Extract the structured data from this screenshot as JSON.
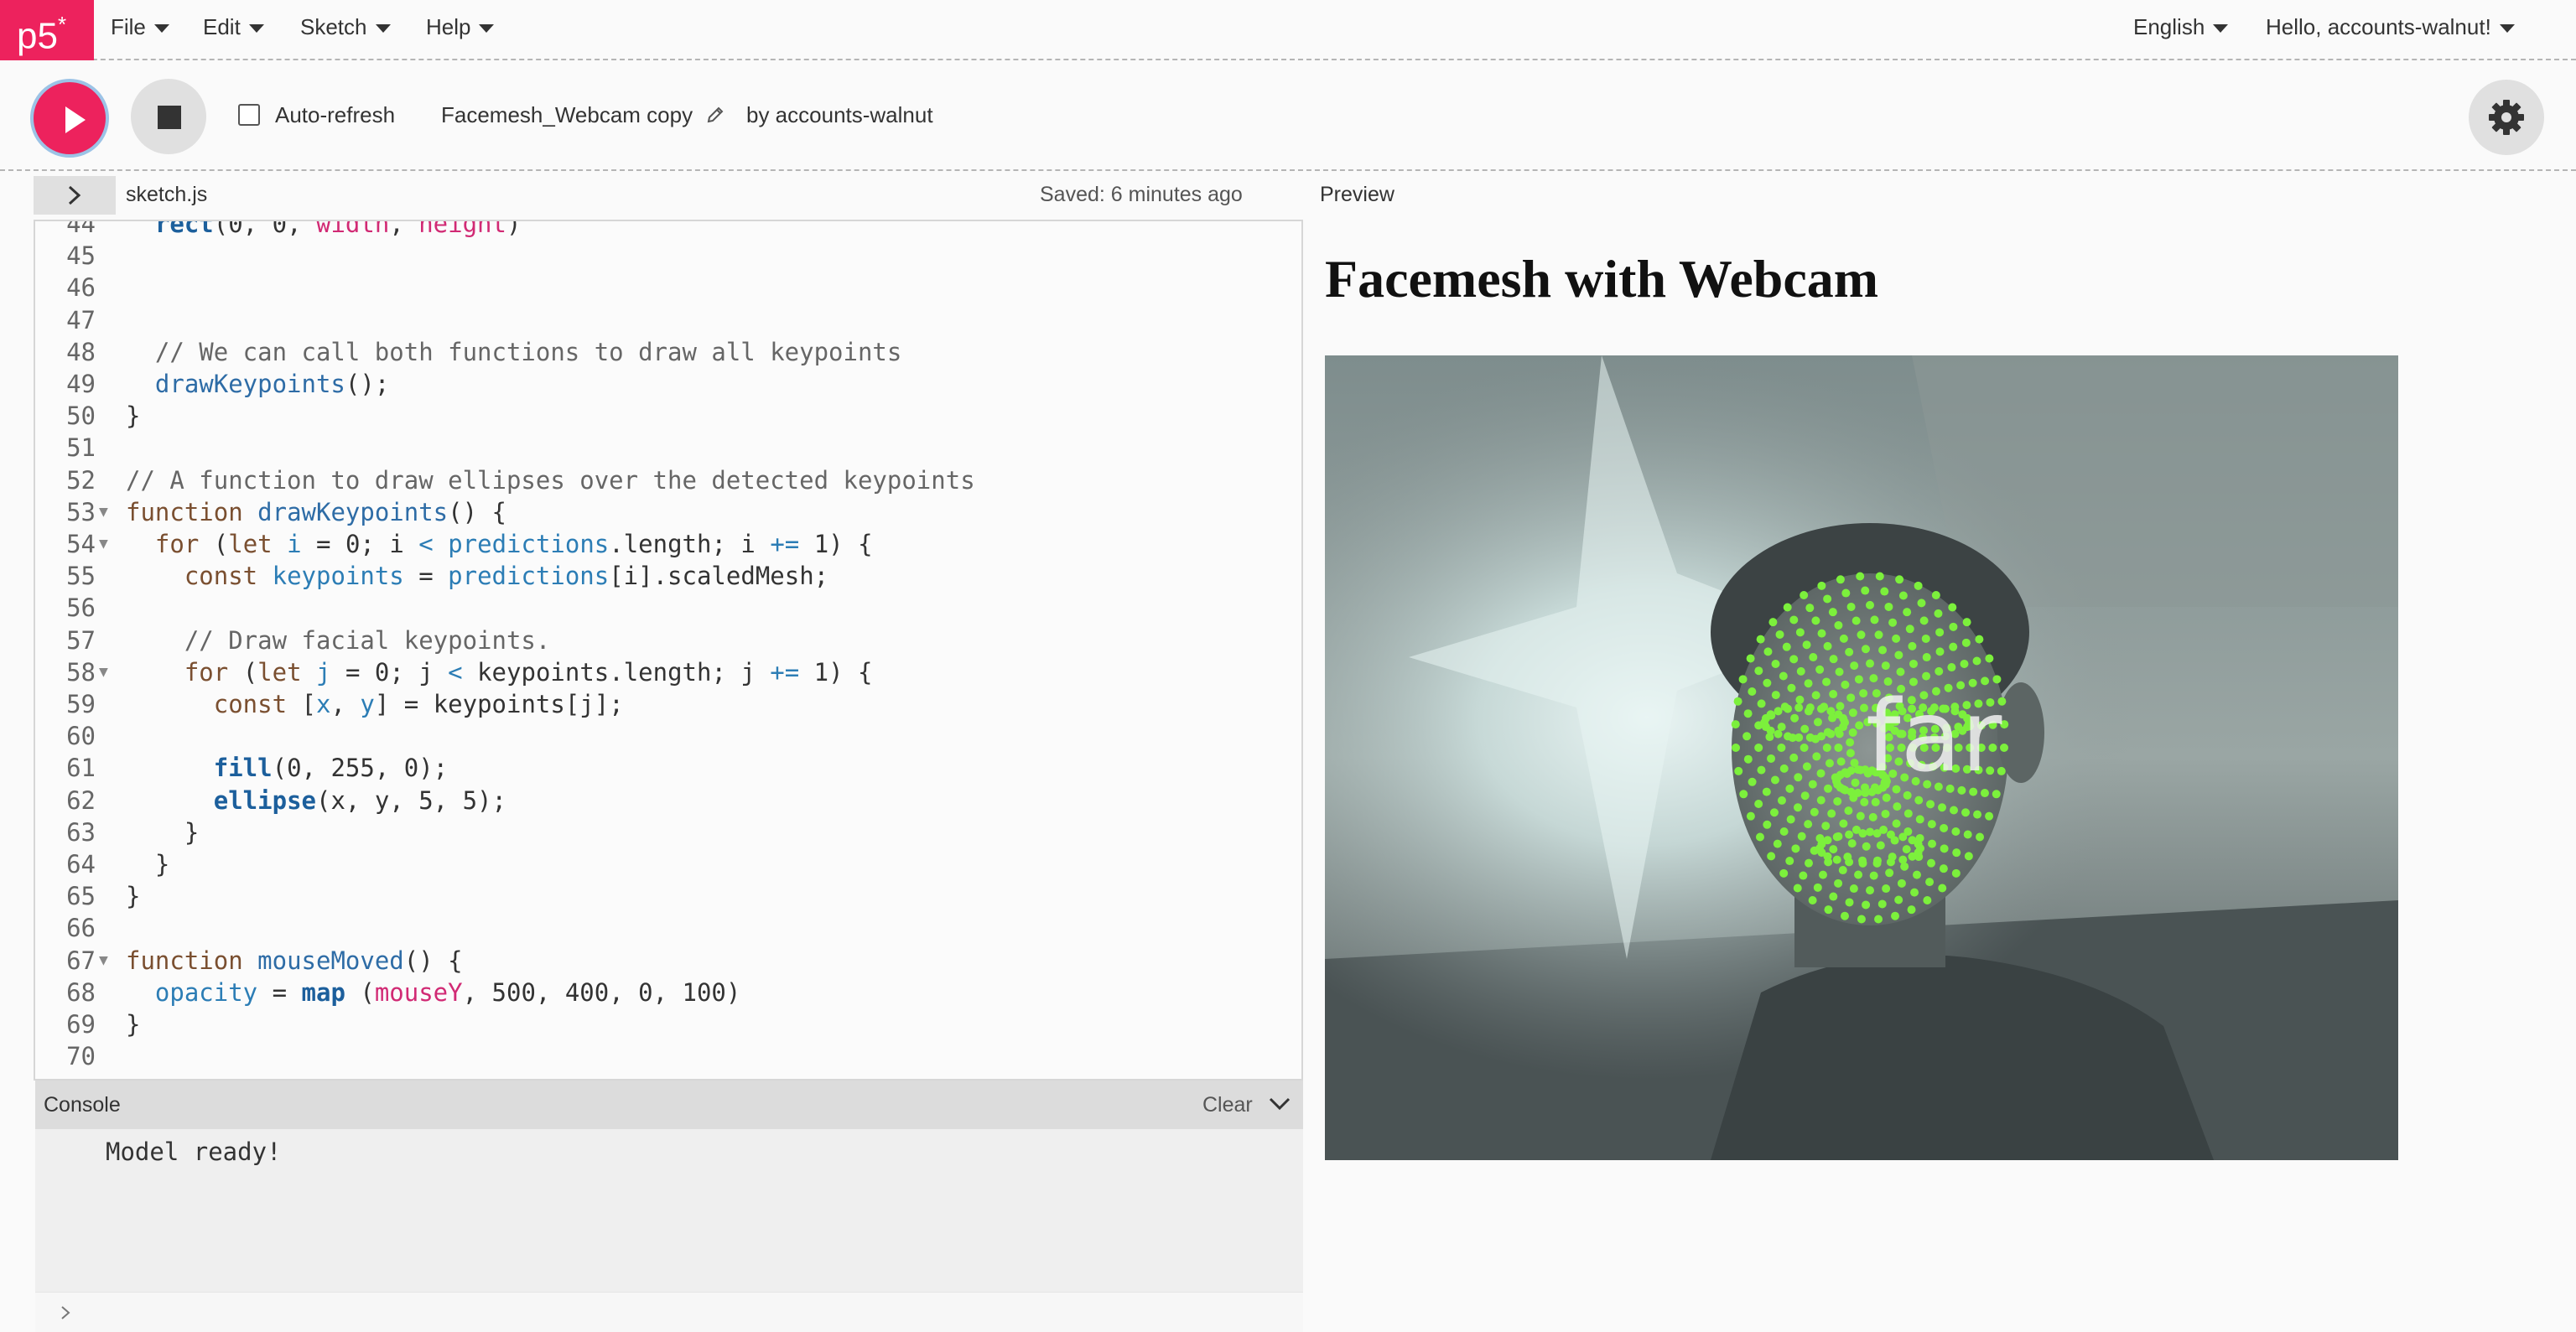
{
  "nav": {
    "logo": "p5",
    "logo_star": "*",
    "menus": [
      "File",
      "Edit",
      "Sketch",
      "Help"
    ],
    "language": "English",
    "user": "Hello, accounts-walnut!"
  },
  "toolbar": {
    "auto_refresh_label": "Auto-refresh",
    "auto_refresh_checked": false,
    "sketch_name": "Facemesh_Webcam copy",
    "byline": "by accounts-walnut"
  },
  "editor": {
    "file_name": "sketch.js",
    "saved_status": "Saved: 6 minutes ago",
    "lines": [
      {
        "n": "44",
        "fold": false,
        "tokens": [
          [
            "",
            "  "
          ],
          [
            "bi",
            "rect"
          ],
          [
            "",
            "(0, 0, "
          ],
          [
            "g",
            "width"
          ],
          [
            "",
            ", "
          ],
          [
            "g",
            "height"
          ],
          [
            "",
            ")"
          ]
        ]
      },
      {
        "n": "45",
        "fold": false,
        "tokens": []
      },
      {
        "n": "46",
        "fold": false,
        "tokens": []
      },
      {
        "n": "47",
        "fold": false,
        "tokens": []
      },
      {
        "n": "48",
        "fold": false,
        "tokens": [
          [
            "c",
            "  // We can call both functions to draw all keypoints"
          ]
        ]
      },
      {
        "n": "49",
        "fold": false,
        "tokens": [
          [
            "",
            "  "
          ],
          [
            "fn",
            "drawKeypoints"
          ],
          [
            "",
            "();"
          ]
        ]
      },
      {
        "n": "50",
        "fold": false,
        "tokens": [
          [
            "",
            "}"
          ]
        ]
      },
      {
        "n": "51",
        "fold": false,
        "tokens": []
      },
      {
        "n": "52",
        "fold": false,
        "tokens": [
          [
            "c",
            "// A function to draw ellipses over the detected keypoints"
          ]
        ]
      },
      {
        "n": "53",
        "fold": true,
        "tokens": [
          [
            "kw",
            "function"
          ],
          [
            "",
            " "
          ],
          [
            "fn",
            "drawKeypoints"
          ],
          [
            "",
            "() {"
          ]
        ]
      },
      {
        "n": "54",
        "fold": true,
        "tokens": [
          [
            "",
            "  "
          ],
          [
            "kw",
            "for"
          ],
          [
            "",
            " ("
          ],
          [
            "kw",
            "let"
          ],
          [
            "",
            " "
          ],
          [
            "var",
            "i"
          ],
          [
            "",
            " = 0; i "
          ],
          [
            "op",
            "<"
          ],
          [
            "",
            " "
          ],
          [
            "var",
            "predictions"
          ],
          [
            "",
            ".length; i "
          ],
          [
            "op",
            "+="
          ],
          [
            "",
            " 1) {"
          ]
        ]
      },
      {
        "n": "55",
        "fold": false,
        "tokens": [
          [
            "",
            "    "
          ],
          [
            "kw",
            "const"
          ],
          [
            "",
            " "
          ],
          [
            "var",
            "keypoints"
          ],
          [
            "",
            " = "
          ],
          [
            "var",
            "predictions"
          ],
          [
            "",
            "[i].scaledMesh;"
          ]
        ]
      },
      {
        "n": "56",
        "fold": false,
        "tokens": []
      },
      {
        "n": "57",
        "fold": false,
        "tokens": [
          [
            "c",
            "    // Draw facial keypoints."
          ]
        ]
      },
      {
        "n": "58",
        "fold": true,
        "tokens": [
          [
            "",
            "    "
          ],
          [
            "kw",
            "for"
          ],
          [
            "",
            " ("
          ],
          [
            "kw",
            "let"
          ],
          [
            "",
            " "
          ],
          [
            "var",
            "j"
          ],
          [
            "",
            " = 0; j "
          ],
          [
            "op",
            "<"
          ],
          [
            "",
            " keypoints.length; j "
          ],
          [
            "op",
            "+="
          ],
          [
            "",
            " 1) {"
          ]
        ]
      },
      {
        "n": "59",
        "fold": false,
        "tokens": [
          [
            "",
            "      "
          ],
          [
            "kw",
            "const"
          ],
          [
            "",
            " ["
          ],
          [
            "var",
            "x"
          ],
          [
            "",
            ", "
          ],
          [
            "var",
            "y"
          ],
          [
            "",
            "] = keypoints[j];"
          ]
        ]
      },
      {
        "n": "60",
        "fold": false,
        "tokens": []
      },
      {
        "n": "61",
        "fold": false,
        "tokens": [
          [
            "",
            "      "
          ],
          [
            "bi",
            "fill"
          ],
          [
            "",
            "(0, 255, 0);"
          ]
        ]
      },
      {
        "n": "62",
        "fold": false,
        "tokens": [
          [
            "",
            "      "
          ],
          [
            "bi",
            "ellipse"
          ],
          [
            "",
            "(x, y, 5, 5);"
          ]
        ]
      },
      {
        "n": "63",
        "fold": false,
        "tokens": [
          [
            "",
            "    }"
          ]
        ]
      },
      {
        "n": "64",
        "fold": false,
        "tokens": [
          [
            "",
            "  }"
          ]
        ]
      },
      {
        "n": "65",
        "fold": false,
        "tokens": [
          [
            "",
            "}"
          ]
        ]
      },
      {
        "n": "66",
        "fold": false,
        "tokens": []
      },
      {
        "n": "67",
        "fold": true,
        "tokens": [
          [
            "kw",
            "function"
          ],
          [
            "",
            " "
          ],
          [
            "fn",
            "mouseMoved"
          ],
          [
            "",
            "() {"
          ]
        ]
      },
      {
        "n": "68",
        "fold": false,
        "tokens": [
          [
            "",
            "  "
          ],
          [
            "var",
            "opacity"
          ],
          [
            "",
            " = "
          ],
          [
            "bi",
            "map"
          ],
          [
            "",
            " ("
          ],
          [
            "g",
            "mouseY"
          ],
          [
            "",
            ", 500, 400, 0, 100)"
          ]
        ]
      },
      {
        "n": "69",
        "fold": false,
        "tokens": [
          [
            "",
            "}"
          ]
        ]
      },
      {
        "n": "70",
        "fold": false,
        "tokens": []
      }
    ]
  },
  "console": {
    "title": "Console",
    "clear_label": "Clear",
    "messages": [
      "Model ready!"
    ]
  },
  "preview": {
    "label": "Preview",
    "heading": "Facemesh with Webcam",
    "overlay_text": "far",
    "keypoint_color": "#7cf03c"
  },
  "colors": {
    "brand": "#ed225d",
    "nav_bg": "#fafafa"
  }
}
